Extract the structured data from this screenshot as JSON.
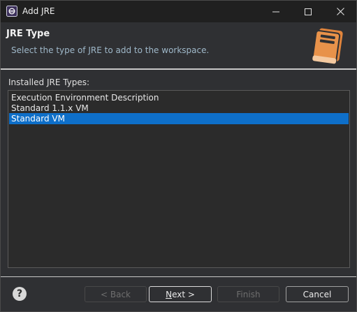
{
  "window": {
    "title": "Add JRE",
    "controls": [
      "minimize-icon",
      "maximize-icon",
      "close-icon"
    ]
  },
  "header": {
    "title": "JRE Type",
    "description": "Select the type of JRE to add to the workspace."
  },
  "list": {
    "label": "Installed JRE Types:",
    "items": [
      {
        "label": "Execution Environment Description",
        "selected": false
      },
      {
        "label": "Standard 1.1.x VM",
        "selected": false
      },
      {
        "label": "Standard VM",
        "selected": true
      }
    ]
  },
  "footer": {
    "help_label": "?",
    "back_label": "< Back",
    "next_mnemonic": "N",
    "next_rest": "ext >",
    "finish_label": "Finish",
    "cancel_label": "Cancel",
    "back_enabled": false,
    "next_enabled": true,
    "finish_enabled": false,
    "cancel_enabled": true
  },
  "colors": {
    "selection": "#0e6fc9",
    "book_icon": "#e0843c",
    "description_text": "#9fb8c9"
  }
}
